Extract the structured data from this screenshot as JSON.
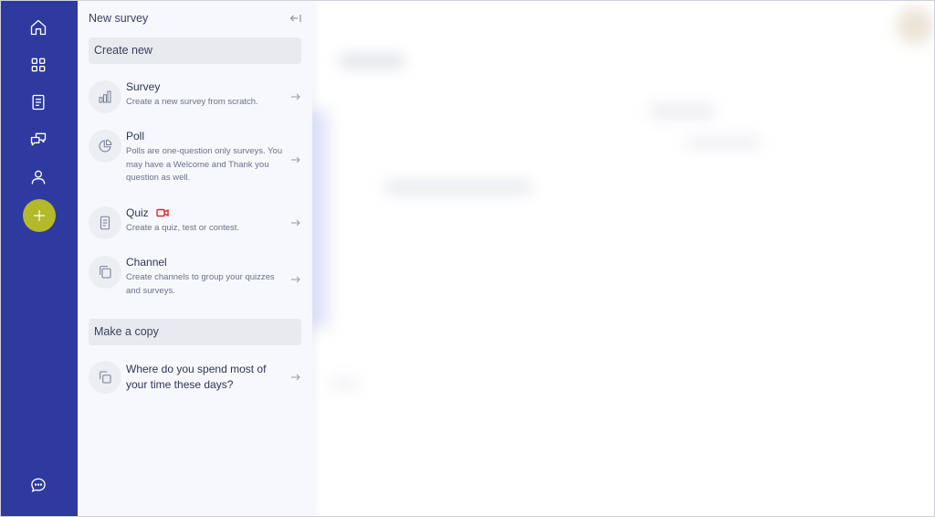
{
  "rail": {
    "items": [
      {
        "icon": "home-icon"
      },
      {
        "icon": "grid-icon"
      },
      {
        "icon": "document-icon"
      },
      {
        "icon": "chat-icon"
      },
      {
        "icon": "user-icon"
      }
    ],
    "add_icon": "plus-icon",
    "support_icon": "chat-bubble-icon"
  },
  "panel": {
    "title": "New survey",
    "create_header": "Create new",
    "options": [
      {
        "title": "Survey",
        "desc": "Create a new survey from scratch.",
        "icon": "bar-chart-icon"
      },
      {
        "title": "Poll",
        "desc": "Polls are one-question only surveys. You may have a Welcome and Thank you question as well.",
        "icon": "pie-chart-icon"
      },
      {
        "title": "Quiz",
        "desc": "Create a quiz, test or contest.",
        "icon": "quiz-document-icon",
        "badge_icon": "video-icon"
      },
      {
        "title": "Channel",
        "desc": "Create channels to group your quizzes and surveys.",
        "icon": "copy-stack-icon"
      }
    ],
    "copy_header": "Make a copy",
    "copy_item": {
      "title": "Where do you spend most of your time these days?",
      "icon": "copy-icon"
    }
  },
  "colors": {
    "rail": "#2e3a9f",
    "accent": "#b4b92a",
    "panel_bg": "#f7f8fd",
    "badge": "#e0262b"
  }
}
